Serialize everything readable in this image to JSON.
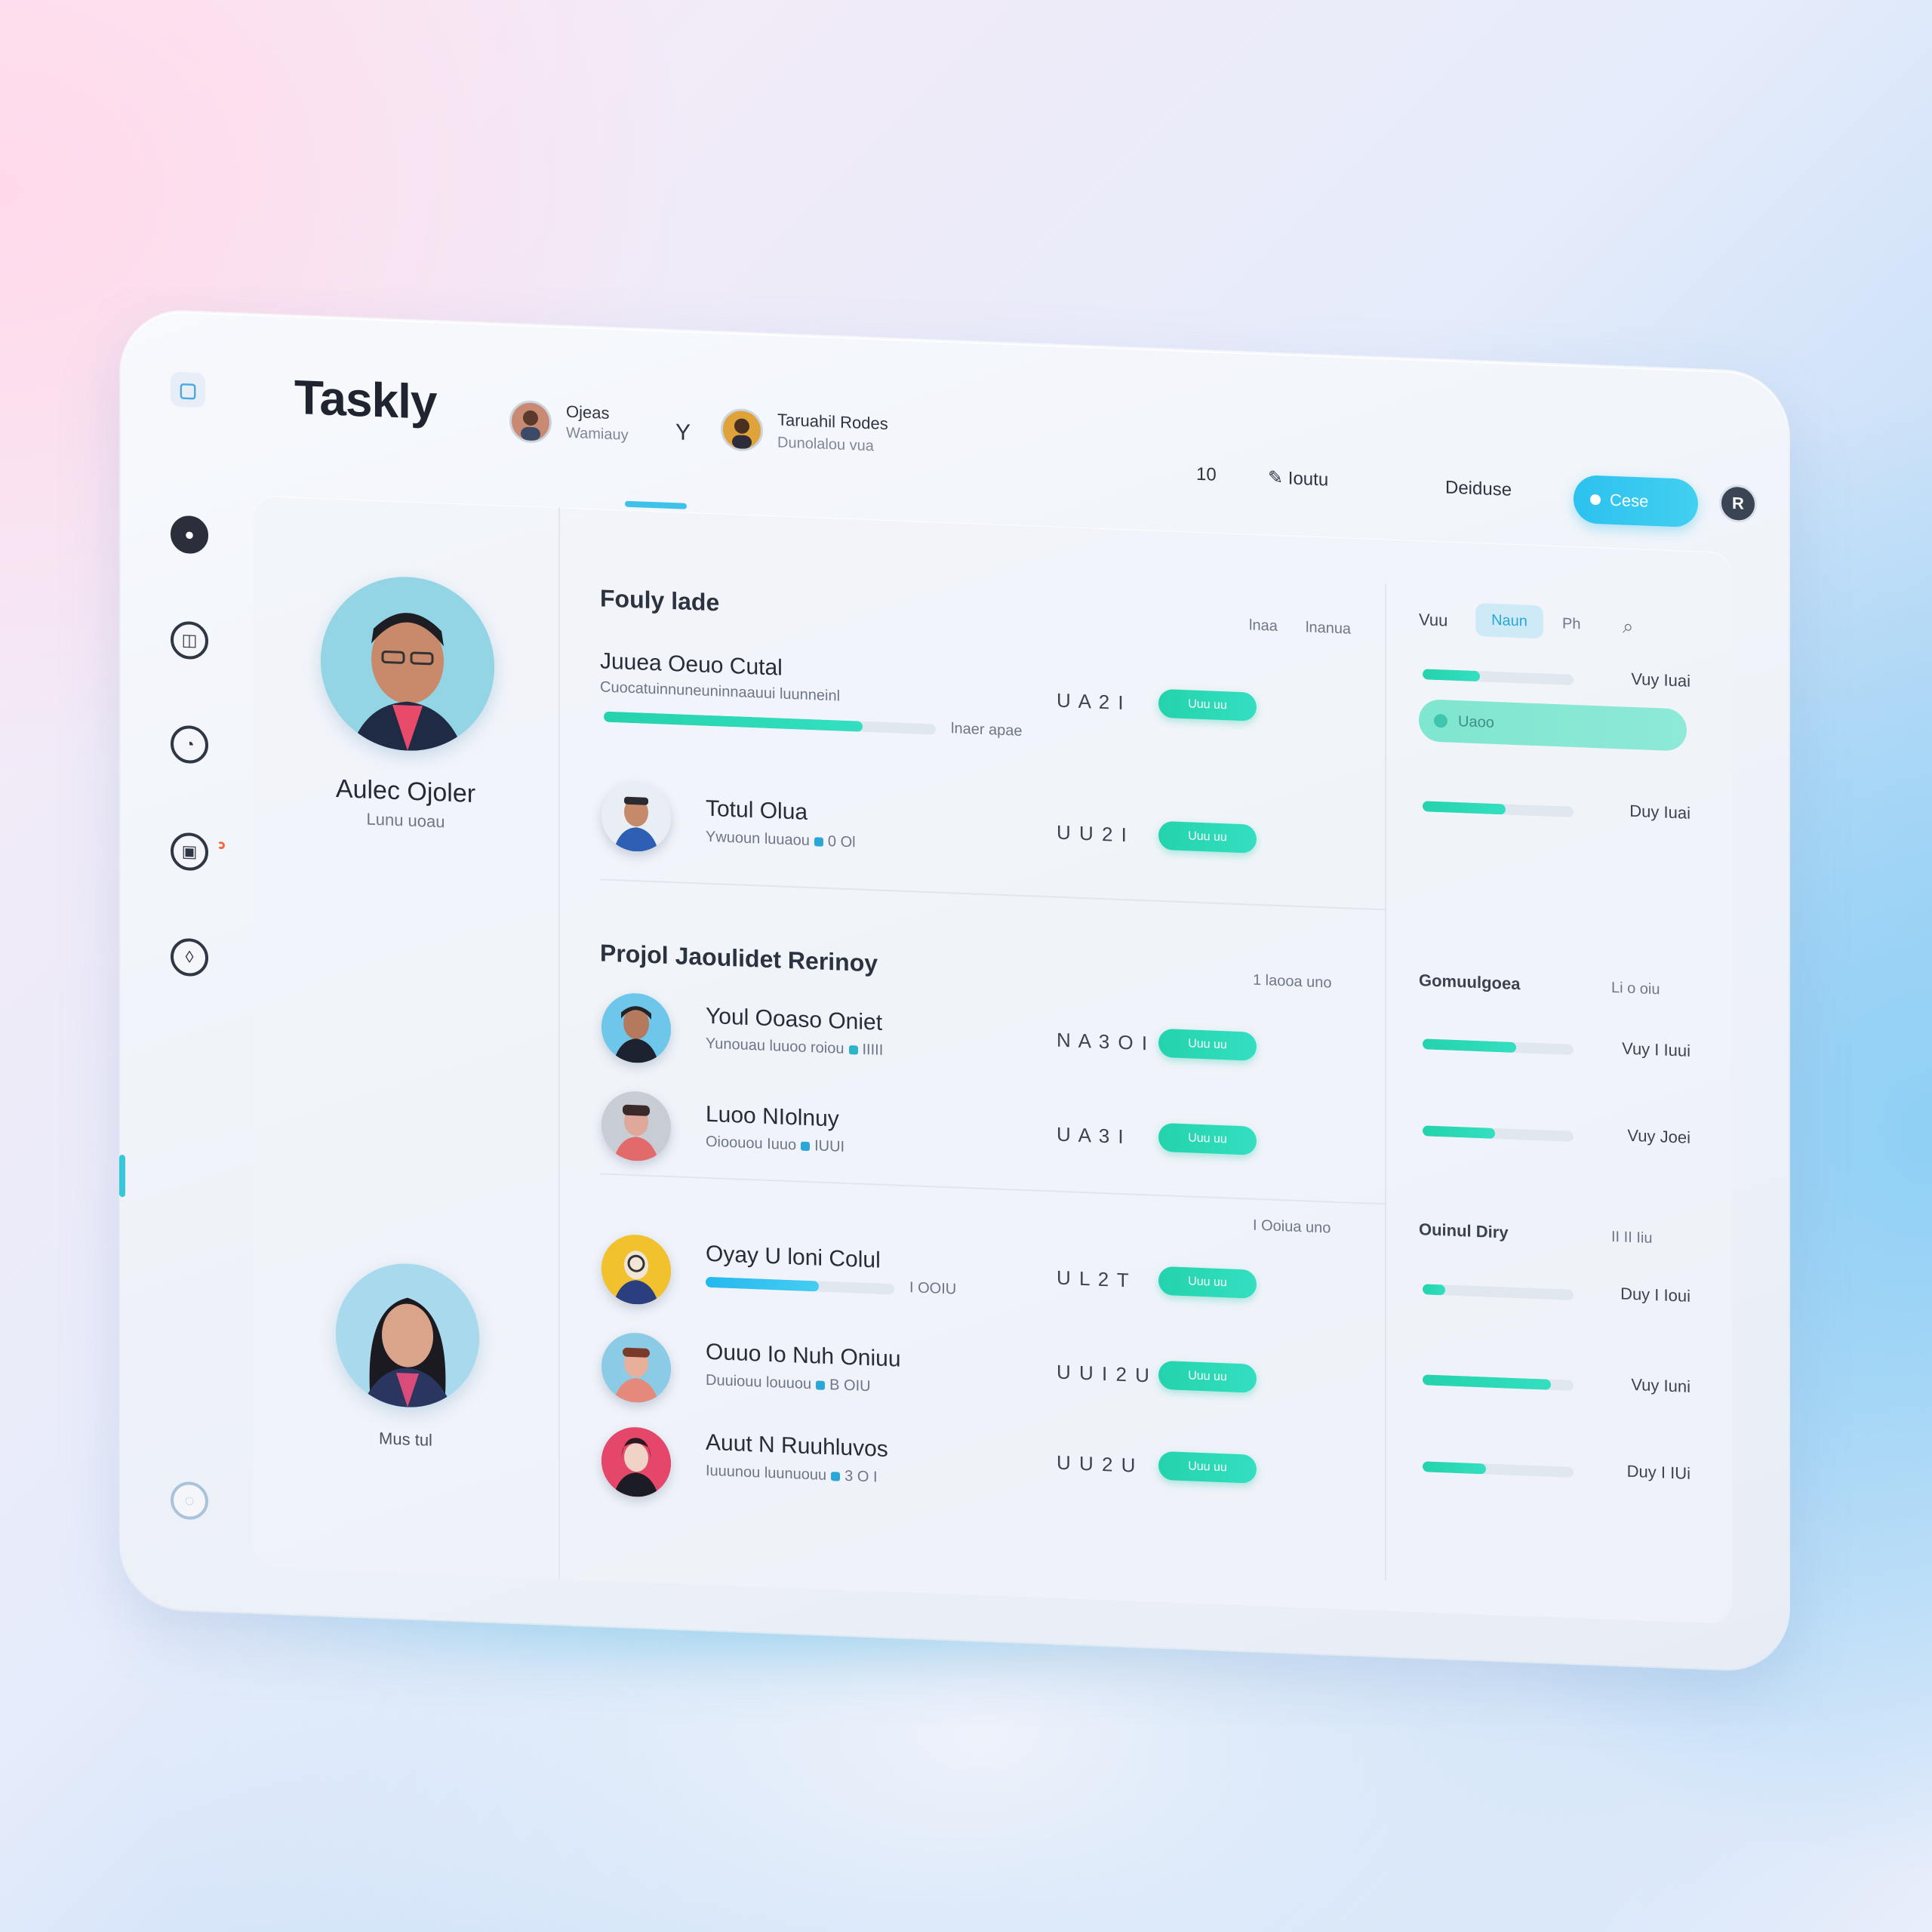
{
  "app": {
    "brand": "Taskly"
  },
  "header": {
    "users": [
      {
        "name": "Ojeas",
        "sub": "Wamiauy"
      },
      {
        "name": "Taruahil Rodes",
        "sub": "Dunolalou vua"
      }
    ],
    "filter_icon": "Y",
    "items": [
      "10",
      "Ioutu",
      "Deiduse"
    ],
    "button_label": "Cese",
    "user_initial": "R"
  },
  "profile": {
    "name": "Aulec Ojoler",
    "sub": "Lunu uoau",
    "second_name": "Mus tul"
  },
  "sections": [
    {
      "title": "Fouly lade",
      "col_heads": [
        "lnaa",
        "lnanua"
      ],
      "tasks": [
        {
          "title": "Juuea Oeuo Cutal",
          "sub": "Cuocatuinnuneuninnaauui luunneinl",
          "date": "U A 2 I",
          "progress": 0.78,
          "progress_label": "lnaer apae"
        },
        {
          "title": "Totul Olua",
          "sub": "Ywuoun luuaou",
          "tag": "0 Ol",
          "date": "U U 2 I",
          "progress": null
        }
      ]
    },
    {
      "title": "Projol Jaoulidet Rerinoy",
      "col_heads": [
        "1 laooa uno"
      ],
      "tasks": [
        {
          "title": "Youl Ooaso Oniet",
          "sub": "Yunouau luuoo roiou",
          "tag": "IIIII",
          "date": "N A 3 O I",
          "progress": null
        },
        {
          "title": "Luoo NIolnuy",
          "sub": "Oioouou Iuuo",
          "tag": "IUUI",
          "date": "U A 3 I",
          "progress": null
        }
      ]
    },
    {
      "title": "",
      "col_heads": [
        "I Ooiua uno"
      ],
      "tasks": [
        {
          "title": "Oyay U loni Colul",
          "sub": "",
          "tag": "I OOIU",
          "date": "U L 2 T",
          "progress": 0.6
        },
        {
          "title": "Ouuo Io Nuh Oniuu",
          "sub": "Duuiouu louuou",
          "tag": "B OIU",
          "date": "U U I 2 U",
          "progress": null
        },
        {
          "title": "Auut N Ruuhluvos",
          "sub": "Iuuunou luunuouu",
          "tag": "3 O I",
          "date": "U U 2 U",
          "progress": null
        }
      ]
    }
  ],
  "right_panel": {
    "head": "Vuu",
    "tab_active": "Naun",
    "tab_other": "Ph",
    "wide_pill_label": "Uaoo",
    "groups": [
      {
        "title": "",
        "rows": [
          {
            "progress": 0.38,
            "label": "Vuy Iuai"
          },
          {
            "progress": 0.55,
            "label": "Duy Iuai"
          }
        ]
      },
      {
        "title": "Gomuulgoea",
        "note": "Li o oiu",
        "rows": [
          {
            "progress": 0.62,
            "label": "Vuy I Iuui"
          },
          {
            "progress": 0.48,
            "label": "Vuy Joei"
          }
        ]
      },
      {
        "title": "Ouinul Diry",
        "note": "II II Iiu",
        "rows": [
          {
            "progress": 0.15,
            "label": "Duy I Ioui"
          },
          {
            "progress": 0.85,
            "label": "Vuy Iuni"
          },
          {
            "progress": 0.42,
            "label": "Duy I IUi"
          }
        ]
      }
    ]
  },
  "pill_label": "Uuu uu",
  "colors": {
    "accent": "#2cc1ef",
    "teal": "#24d3ad"
  }
}
